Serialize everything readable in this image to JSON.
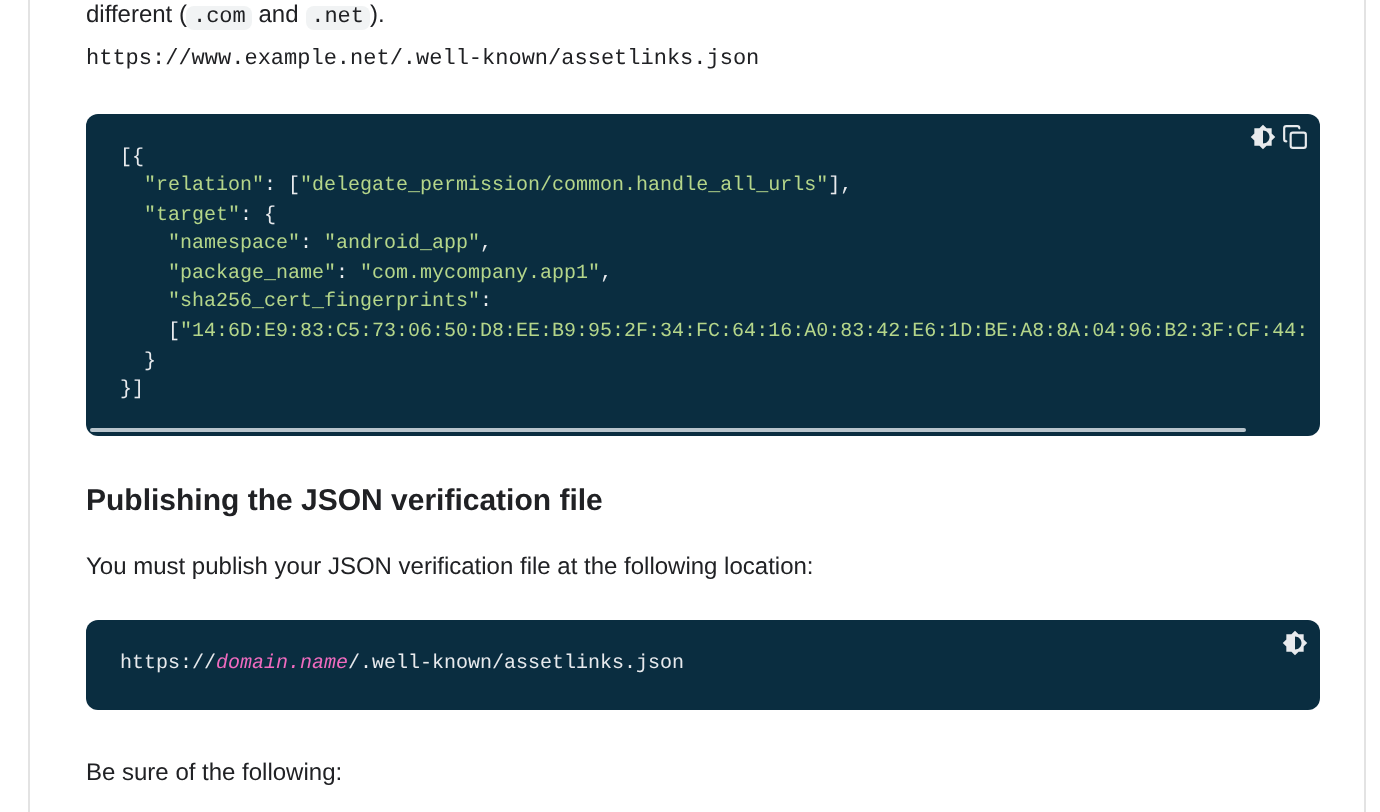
{
  "intro": [
    {
      "kind": "text",
      "t": "different ("
    },
    {
      "kind": "code",
      "t": ".com"
    },
    {
      "kind": "text",
      "t": " and "
    },
    {
      "kind": "code",
      "t": ".net"
    },
    {
      "kind": "text",
      "t": ")."
    }
  ],
  "example_url": "https://www.example.net/.well-known/assetlinks.json",
  "code_block": {
    "lines": [
      {
        "tokens": [
          {
            "kind": "punct",
            "t": "[{"
          }
        ],
        "children": [
          {
            "tokens": [
              {
                "kind": "str",
                "t": "\"relation\""
              },
              {
                "kind": "punct",
                "t": ": ["
              },
              {
                "kind": "str",
                "t": "\"delegate_permission/common.handle_all_urls\""
              },
              {
                "kind": "punct",
                "t": "],"
              }
            ]
          },
          {
            "tokens": [
              {
                "kind": "str",
                "t": "\"target\""
              },
              {
                "kind": "punct",
                "t": ": {"
              }
            ],
            "children": [
              {
                "tokens": [
                  {
                    "kind": "str",
                    "t": "\"namespace\""
                  },
                  {
                    "kind": "punct",
                    "t": ": "
                  },
                  {
                    "kind": "str",
                    "t": "\"android_app\""
                  },
                  {
                    "kind": "punct",
                    "t": ","
                  }
                ]
              },
              {
                "tokens": [
                  {
                    "kind": "str",
                    "t": "\"package_name\""
                  },
                  {
                    "kind": "punct",
                    "t": ": "
                  },
                  {
                    "kind": "str",
                    "t": "\"com.mycompany.app1\""
                  },
                  {
                    "kind": "punct",
                    "t": ","
                  }
                ]
              },
              {
                "tokens": [
                  {
                    "kind": "str",
                    "t": "\"sha256_cert_fingerprints\""
                  },
                  {
                    "kind": "punct",
                    "t": ":"
                  }
                ]
              },
              {
                "tokens": [
                  {
                    "kind": "punct",
                    "t": "["
                  },
                  {
                    "kind": "str",
                    "t": "\"14:6D:E9:83:C5:73:06:50:D8:EE:B9:95:2F:34:FC:64:16:A0:83:42:E6:1D:BE:A8:8A:04:96:B2:3F:CF:44:"
                  }
                ]
              }
            ]
          },
          {
            "tokens": [
              {
                "kind": "punct",
                "t": "}"
              }
            ]
          }
        ]
      },
      {
        "tokens": [
          {
            "kind": "punct",
            "t": "}]"
          }
        ]
      }
    ],
    "copy_button": true
  },
  "heading": "Publishing the JSON verification file",
  "paragraph": "You must publish your JSON verification file at the following location:",
  "location_block": {
    "lines": [
      {
        "tokens": [
          {
            "kind": "plain",
            "t": "https://"
          },
          {
            "kind": "var",
            "t": "domain.name"
          },
          {
            "kind": "plain",
            "t": "/.well-known/assetlinks.json"
          }
        ]
      }
    ]
  },
  "footer_text": "Be sure of the following:"
}
